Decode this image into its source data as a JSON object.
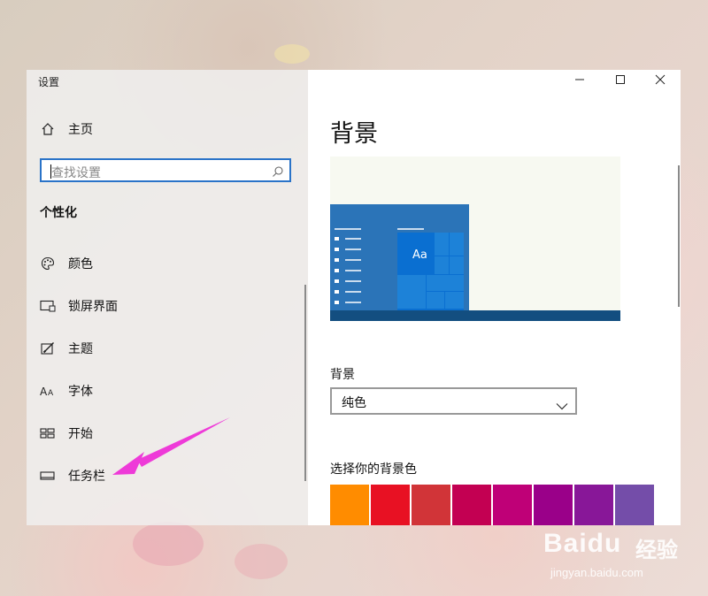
{
  "window": {
    "title": "设置",
    "controls": {
      "minimize": "—",
      "maximize": "☐",
      "close": "✕"
    }
  },
  "sidebar": {
    "home_label": "主页",
    "search_placeholder": "查找设置",
    "section_title": "个性化",
    "items": [
      {
        "label": "颜色",
        "icon": "palette-icon"
      },
      {
        "label": "锁屏界面",
        "icon": "lock-screen-icon"
      },
      {
        "label": "主题",
        "icon": "theme-brush-icon"
      },
      {
        "label": "字体",
        "icon": "font-icon"
      },
      {
        "label": "开始",
        "icon": "start-icon"
      },
      {
        "label": "任务栏",
        "icon": "taskbar-icon"
      }
    ]
  },
  "main": {
    "heading": "背景",
    "preview": {
      "sample_text": "Aa"
    },
    "background_label": "背景",
    "background_value": "纯色",
    "color_label": "选择你的背景色",
    "swatches": [
      "#ff8c00",
      "#e81123",
      "#d13438",
      "#c30052",
      "#bf0077",
      "#9a0089",
      "#881798",
      "#744da9"
    ]
  },
  "colors": {
    "accent": "#0078d7",
    "annotation_arrow": "#ee3ad8"
  },
  "watermark": {
    "brand": "Baidu",
    "cn": "经验",
    "url": "jingyan.baidu.com"
  }
}
